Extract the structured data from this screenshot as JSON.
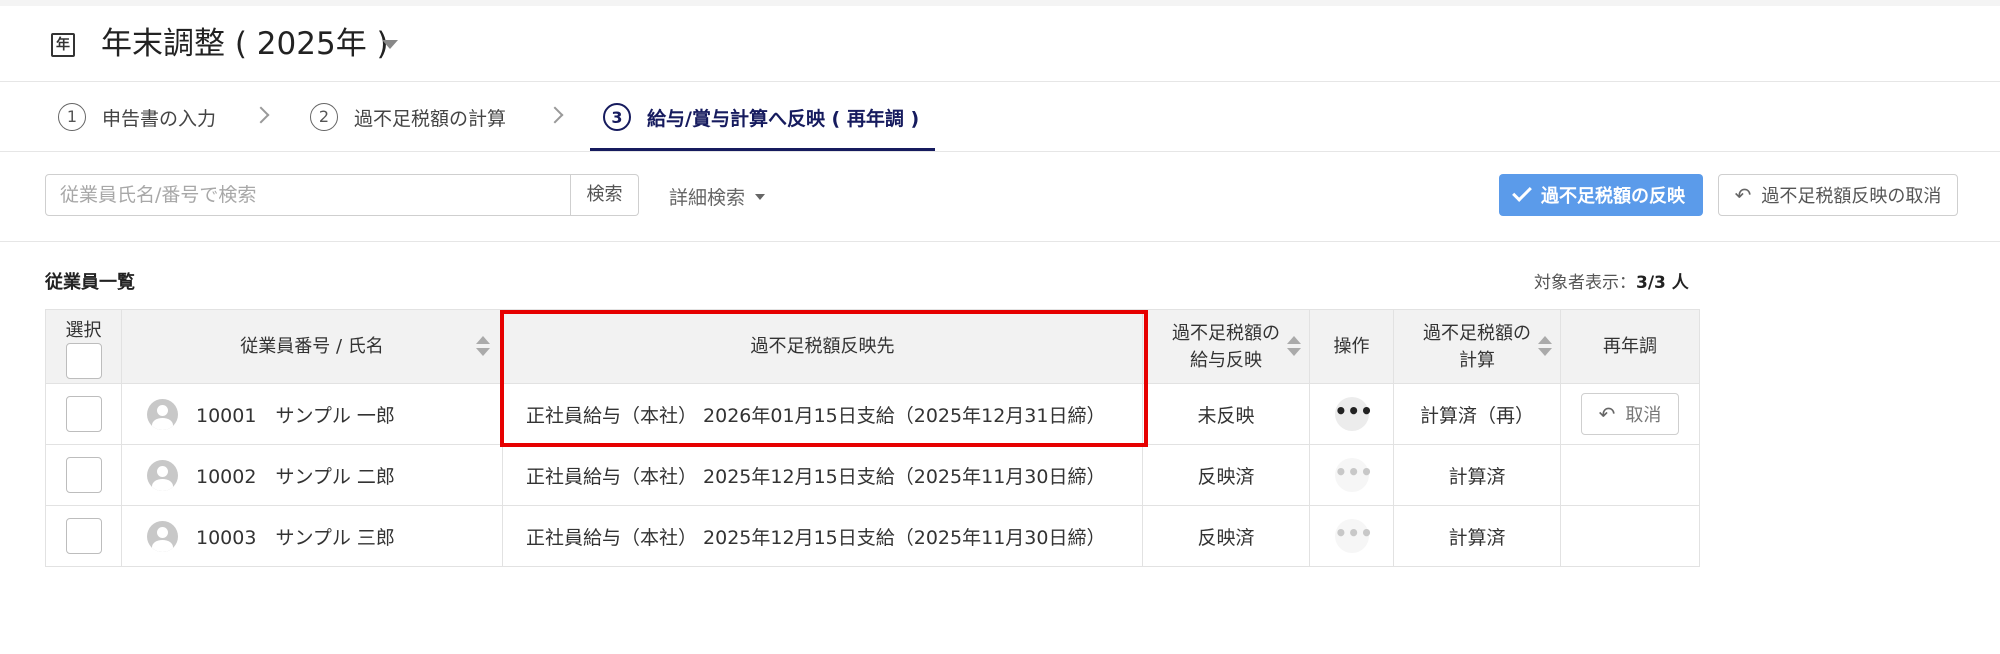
{
  "header": {
    "icon_glyph": "年",
    "icon_name": "calendar-year-icon",
    "title": "年末調整 ( 2025年 )"
  },
  "steps": [
    {
      "num": "1",
      "label": "申告書の入力",
      "active": false
    },
    {
      "num": "2",
      "label": "過不足税額の計算",
      "active": false
    },
    {
      "num": "3",
      "label": "給与/賞与計算へ反映 ( 再年調 )",
      "active": true
    }
  ],
  "toolbar": {
    "search_placeholder": "従業員氏名/番号で検索",
    "search_value": "",
    "search_label": "検索",
    "advanced_search_label": "詳細検索",
    "reflect_label": "過不足税額の反映",
    "cancel_reflect_label": "過不足税額反映の取消",
    "accent_color": "#5b9bea"
  },
  "list": {
    "title": "従業員一覧",
    "count_label": "対象者表示：",
    "count_value": "3/3 人"
  },
  "table": {
    "headers": {
      "select": "選択",
      "employee": "従業員番号 / 氏名",
      "destination": "過不足税額反映先",
      "salary_reflect_line1": "過不足税額の",
      "salary_reflect_line2": "給与反映",
      "action": "操作",
      "calc_line1": "過不足税額の",
      "calc_line2": "計算",
      "readjust": "再年調"
    },
    "rows": [
      {
        "employee": "10001　サンプル 一郎",
        "destination": "正社員給与（本社） 2026年01月15日支給（2025年12月31日締）",
        "status": "未反映",
        "status_color": "#d40000",
        "action_glyph": "•••",
        "action_enabled": true,
        "calc": "計算済（再）",
        "readjust_label": "取消"
      },
      {
        "employee": "10002　サンプル 二郎",
        "destination": "正社員給与（本社） 2025年12月15日支給（2025年11月30日締）",
        "status": "反映済",
        "status_color": "#1c6ed6",
        "action_glyph": "•••",
        "action_enabled": false,
        "calc": "計算済",
        "readjust_label": ""
      },
      {
        "employee": "10003　サンプル 三郎",
        "destination": "正社員給与（本社） 2025年12月15日支給（2025年11月30日締）",
        "status": "反映済",
        "status_color": "#1c6ed6",
        "action_glyph": "•••",
        "action_enabled": false,
        "calc": "計算済",
        "readjust_label": ""
      }
    ]
  },
  "highlight_color": "#e60000"
}
